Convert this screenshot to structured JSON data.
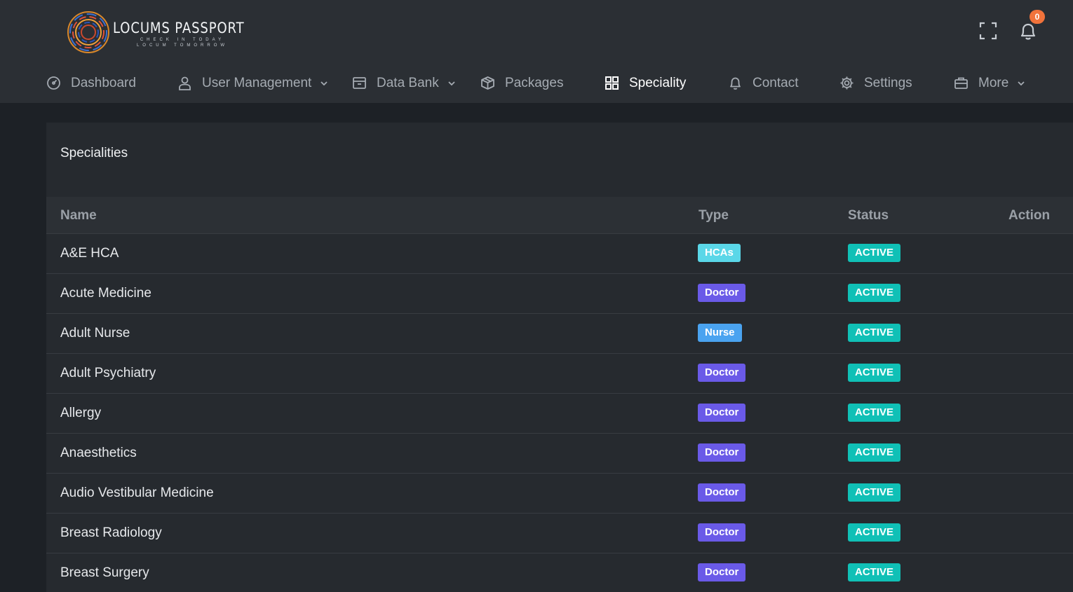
{
  "brand": {
    "name": "LOCUMS PASSPORT",
    "tagline_1": "CHECK IN TODAY",
    "tagline_2": "LOCUM TOMORROW"
  },
  "header": {
    "notification_count": "0"
  },
  "nav": {
    "items": [
      {
        "label": "Dashboard",
        "icon": "dashboard-gauge-icon"
      },
      {
        "label": "User Management",
        "icon": "user-icon",
        "dropdown": true
      },
      {
        "label": "Data Bank",
        "icon": "archive-box-icon",
        "dropdown": true
      },
      {
        "label": "Packages",
        "icon": "package-icon"
      },
      {
        "label": "Speciality",
        "icon": "grid-icon",
        "active": true
      },
      {
        "label": "Contact",
        "icon": "bell-icon"
      },
      {
        "label": "Settings",
        "icon": "gear-icon"
      },
      {
        "label": "More",
        "icon": "briefcase-icon",
        "dropdown": true
      }
    ]
  },
  "card": {
    "title": "Specialities",
    "columns": {
      "name": "Name",
      "type": "Type",
      "status": "Status",
      "action": "Action"
    },
    "rows": [
      {
        "name": "A&E HCA",
        "type": "HCAs",
        "status": "ACTIVE"
      },
      {
        "name": "Acute Medicine",
        "type": "Doctor",
        "status": "ACTIVE"
      },
      {
        "name": "Adult Nurse",
        "type": "Nurse",
        "status": "ACTIVE"
      },
      {
        "name": "Adult Psychiatry",
        "type": "Doctor",
        "status": "ACTIVE"
      },
      {
        "name": "Allergy",
        "type": "Doctor",
        "status": "ACTIVE"
      },
      {
        "name": "Anaesthetics",
        "type": "Doctor",
        "status": "ACTIVE"
      },
      {
        "name": "Audio Vestibular Medicine",
        "type": "Doctor",
        "status": "ACTIVE"
      },
      {
        "name": "Breast Radiology",
        "type": "Doctor",
        "status": "ACTIVE"
      },
      {
        "name": "Breast Surgery",
        "type": "Doctor",
        "status": "ACTIVE"
      }
    ]
  },
  "colors": {
    "type_doctor": "#6a5ae8",
    "type_nurse": "#4aa3f0",
    "type_hcas": "#5ad7e8",
    "status_active": "#10c0b6",
    "badge_notification": "#f1733b"
  }
}
